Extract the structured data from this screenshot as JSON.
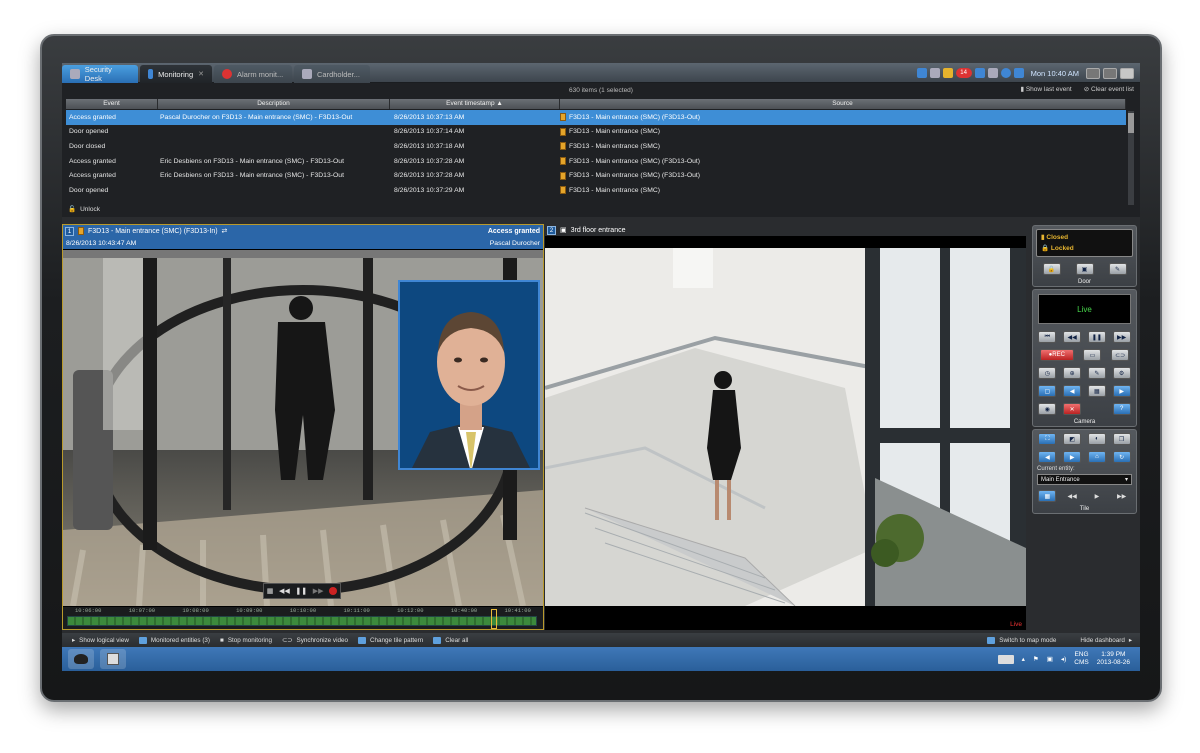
{
  "tabs": [
    {
      "label": "Security Desk"
    },
    {
      "label": "Monitoring"
    },
    {
      "label": "Alarm monit..."
    },
    {
      "label": "Cardholder..."
    }
  ],
  "tray_top": {
    "badge": "14",
    "time": "Mon 10:40 AM"
  },
  "events": {
    "count_text": "630 items (1 selected)",
    "show_last_event": "Show last event",
    "clear_event_list": "Clear event list",
    "columns": [
      "Event",
      "Description",
      "Event timestamp",
      "Source"
    ],
    "rows": [
      {
        "event": "Access granted",
        "description": "Pascal Durocher on F3D13 - Main entrance (SMC) - F3D13-Out",
        "timestamp": "8/26/2013 10:37:13 AM",
        "source": "F3D13 - Main entrance (SMC) (F3D13-Out)"
      },
      {
        "event": "Door opened",
        "description": "",
        "timestamp": "8/26/2013 10:37:14 AM",
        "source": "F3D13 - Main entrance (SMC)"
      },
      {
        "event": "Door closed",
        "description": "",
        "timestamp": "8/26/2013 10:37:18 AM",
        "source": "F3D13 - Main entrance (SMC)"
      },
      {
        "event": "Access granted",
        "description": "Eric Desbiens on F3D13 - Main entrance (SMC) - F3D13-Out",
        "timestamp": "8/26/2013 10:37:28 AM",
        "source": "F3D13 - Main entrance (SMC) (F3D13-Out)"
      },
      {
        "event": "Access granted",
        "description": "Eric Desbiens on F3D13 - Main entrance (SMC) - F3D13-Out",
        "timestamp": "8/26/2013 10:37:28 AM",
        "source": "F3D13 - Main entrance (SMC) (F3D13-Out)"
      },
      {
        "event": "Door opened",
        "description": "",
        "timestamp": "8/26/2013 10:37:29 AM",
        "source": "F3D13 - Main entrance (SMC)"
      }
    ],
    "unlock": "Unlock"
  },
  "tile1": {
    "num": "1",
    "title": "F3D13 - Main entrance (SMC) (F3D13-In)",
    "status": "Access granted",
    "timestamp": "8/26/2013 10:43:47 AM",
    "person": "Pascal Durocher",
    "timeline_labels": [
      "10:06:00",
      "10:07:00",
      "10:08:00",
      "10:09:00",
      "10:10:00",
      "10:11:00",
      "10:12:00",
      "10:40:00",
      "10:41:00"
    ]
  },
  "tile2": {
    "num": "2",
    "title": "3rd floor entrance",
    "live": "Live"
  },
  "dashboard": {
    "door": {
      "status1": "Closed",
      "status2": "Locked",
      "title": "Door"
    },
    "camera": {
      "live": "Live",
      "rec": "REC",
      "title": "Camera"
    },
    "tile": {
      "current_entity_label": "Current entity:",
      "entity": "Main Entrance",
      "title": "Tile"
    }
  },
  "bottombar": {
    "show_logical_view": "Show logical view",
    "monitored_entities": "Monitored entities (3)",
    "stop_monitoring": "Stop monitoring",
    "synchronize_video": "Synchronize video",
    "change_tile_pattern": "Change tile pattern",
    "clear_all": "Clear all",
    "switch_to_map": "Switch to map mode",
    "hide_dashboard": "Hide dashboard"
  },
  "taskbar": {
    "lang": "ENG",
    "lang2": "CMS",
    "time": "1:39 PM",
    "date": "2013-08-26"
  }
}
